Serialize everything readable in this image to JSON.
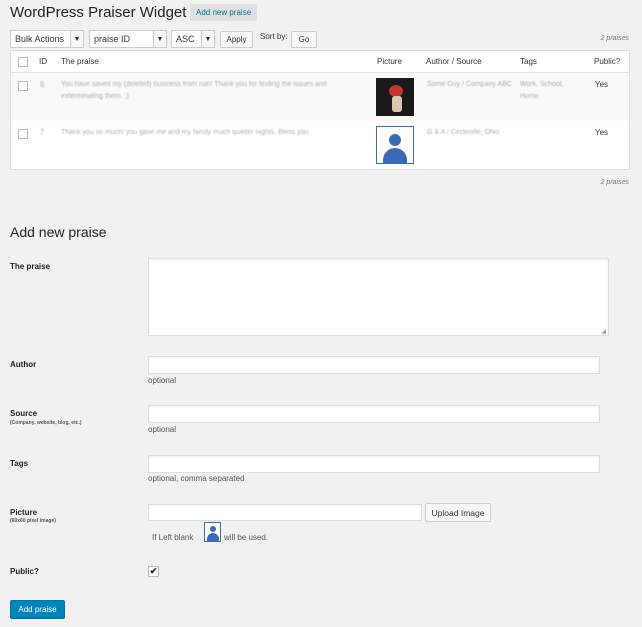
{
  "header": {
    "title": "WordPress Praiser Widget",
    "add_new_label": "Add new praise"
  },
  "toolbar": {
    "bulk_actions": "Bulk Actions",
    "orderby": "praise ID",
    "order": "ASC",
    "apply_label": "Apply",
    "sortby_label": "Sort by:",
    "go_label": "Go",
    "count_top": "2 praises",
    "count_bottom": "2 praises"
  },
  "table": {
    "columns": [
      "ID",
      "The praise",
      "Picture",
      "Author / Source",
      "Tags",
      "Public?"
    ],
    "rows": [
      {
        "id": "6",
        "praise": "You have saved my (deleted) business from ruin! Thank you for finding the issues and exterminating them. :)",
        "author": "Some Guy / Company ABC",
        "tags": "Work, School, Home",
        "public": "Yes"
      },
      {
        "id": "7",
        "praise": "Thank you so much! you gave me and my family much quieter nights. Bless you",
        "author": "G & A / Circleville, Ohio",
        "tags": "",
        "public": "Yes"
      }
    ]
  },
  "form": {
    "heading": "Add new praise",
    "praise_label": "The praise",
    "author_label": "Author",
    "author_hint": "optional",
    "source_label": "Source",
    "source_sublabel": "(Company, website, blog, etc.)",
    "source_hint": "optional",
    "tags_label": "Tags",
    "tags_hint": "optional, comma separated",
    "picture_label": "Picture",
    "picture_sublabel": "(60x60 pixel image)",
    "upload_label": "Upload Image",
    "left_blank_prefix": "If Left blank",
    "left_blank_suffix": "will be used.",
    "public_label": "Public?",
    "public_checked": true,
    "submit_label": "Add praise"
  },
  "colors": {
    "accent": "#0085ba",
    "avatar_blue": "#3c6bb5",
    "link": "#0073aa"
  }
}
